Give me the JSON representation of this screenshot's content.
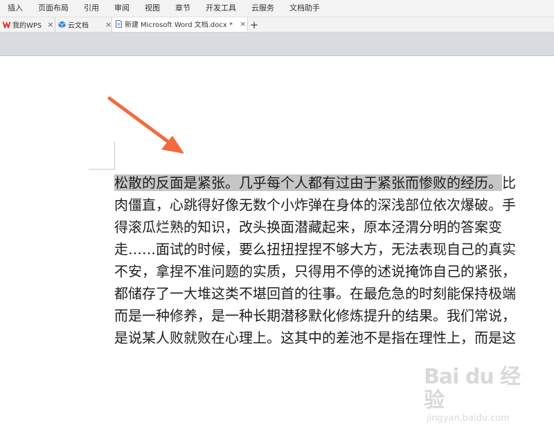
{
  "menu": [
    "插入",
    "页面布局",
    "引用",
    "审阅",
    "视图",
    "章节",
    "开发工具",
    "云服务",
    "文档助手"
  ],
  "tabs": [
    {
      "label": "我的WPS",
      "icon": "wps-logo-icon",
      "active": false
    },
    {
      "label": "云文档",
      "icon": "cloud-box-icon",
      "active": false
    },
    {
      "label": "新建 Microsoft Word 文档.docx *",
      "icon": "document-icon",
      "active": true
    }
  ],
  "tab_close": "×",
  "tab_add": "+",
  "document": {
    "selected": "松散的反面是紧张。几乎每个人都有过由于紧张而惨败的经历。",
    "line1_rest": "比",
    "lines": [
      "肉僵直，心跳得好像无数个小炸弹在身体的深浅部位依次爆破。手",
      "得滚瓜烂熟的知识，改头换面潜藏起来，原本泾渭分明的答案变",
      "走……面试的时候，要么扭扭捏捏不够大方，无法表现自己的真实",
      "不安，拿捏不准问题的实质，只得用不停的述说掩饰自己的紧张，",
      "都储存了一大堆这类不堪回首的往事。在最危急的时刻能保持极端",
      "而是一种修养，是一种长期潜移默化修炼提升的结果。我们常说，",
      "是说某人败就败在心理上。这其中的差池不是指在理性上，而是这"
    ]
  },
  "watermark": {
    "logo": "Bai du 经验",
    "url": "jingyan.baidu.com"
  },
  "colors": {
    "arrow": "#f26a3d",
    "selection": "#c6c6c6",
    "toolband": "#d8dbe0",
    "wps_red": "#e2231a",
    "cloud_blue": "#3a86d8"
  }
}
